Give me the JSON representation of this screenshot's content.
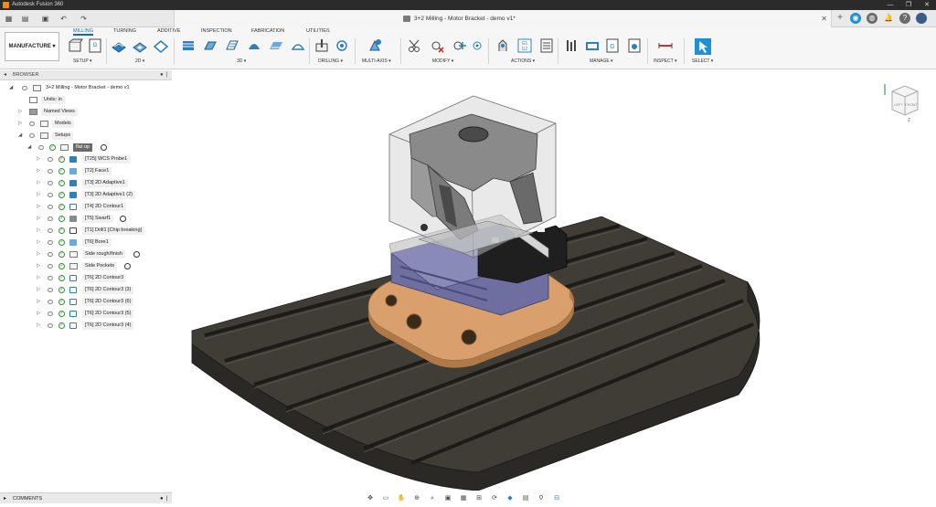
{
  "window": {
    "app_title": "Autodesk Fusion 360",
    "controls": [
      "—",
      "❐",
      "✕"
    ]
  },
  "quick_access": {
    "icons": [
      "grid-icon",
      "file-icon",
      "save-icon",
      "undo-icon",
      "redo-icon"
    ],
    "glyphs": [
      "▦",
      "▤",
      "▣",
      "↶",
      "↷"
    ]
  },
  "document": {
    "title": "3+2 Milling - Motor Bracket - demo v1*",
    "close": "✕"
  },
  "right_controls": {
    "add": "+",
    "glyphs": [
      "◉",
      "◍",
      "🔔",
      "?"
    ]
  },
  "ribbon": {
    "workspace": "MANUFACTURE ▾",
    "tabs": [
      "MILLING",
      "TURNING",
      "ADDITIVE",
      "INSPECTION",
      "FABRICATION",
      "UTILITIES"
    ],
    "active_tab": "MILLING",
    "groups": [
      {
        "label": "SETUP ▾"
      },
      {
        "label": "2D ▾"
      },
      {
        "label": "3D ▾"
      },
      {
        "label": "DRILLING ▾"
      },
      {
        "label": "MULTI-AXIS ▾"
      },
      {
        "label": "MODIFY ▾"
      },
      {
        "label": "ACTIONS ▾"
      },
      {
        "label": "MANAGE ▾"
      },
      {
        "label": "INSPECT ▾"
      },
      {
        "label": "SELECT ▾"
      }
    ],
    "actions_g1g2": "G1\nG2",
    "setup_g": "G"
  },
  "browser": {
    "title": "BROWSER",
    "tree": [
      {
        "label": "3+2 Milling - Motor Bracket - demo v1",
        "level": 0
      },
      {
        "label": "Units: in",
        "level": 1
      },
      {
        "label": "Named Views",
        "level": 1
      },
      {
        "label": "Models",
        "level": 1
      },
      {
        "label": "Setups",
        "level": 1
      },
      {
        "label": "flat op",
        "level": 2,
        "selected": true
      },
      {
        "label": "[T25] WCS Probe1",
        "level": 3
      },
      {
        "label": "[T2] Face1",
        "level": 3
      },
      {
        "label": "[T3] 2D Adaptive1",
        "level": 3
      },
      {
        "label": "[T3] 2D Adaptive1 (2)",
        "level": 3
      },
      {
        "label": "[T4] 2D Contour1",
        "level": 3
      },
      {
        "label": "[T5] Swarf1",
        "level": 3
      },
      {
        "label": "[T1] Drill1 [Chip breaking]",
        "level": 3
      },
      {
        "label": "[T6] Bore1",
        "level": 3
      },
      {
        "label": "Side rough/finish",
        "level": 3
      },
      {
        "label": "Side Pockets",
        "level": 3
      },
      {
        "label": "[T6] 2D Contour3",
        "level": 3
      },
      {
        "label": "[T6] 2D Contour3 (3)",
        "level": 3
      },
      {
        "label": "[T6] 2D Contour3 (6)",
        "level": 3
      },
      {
        "label": "[T6] 2D Contour3 (5)",
        "level": 3
      },
      {
        "label": "[T6] 2D Contour3 (4)",
        "level": 3
      }
    ]
  },
  "comments": {
    "title": "COMMENTS"
  },
  "viewcube": {
    "left": "LEFT",
    "front": "FRONT",
    "axis": "Z"
  },
  "navbar": {
    "icons": [
      "orbit-icon",
      "pan-icon",
      "hand-icon",
      "zoom-icon",
      "fit-icon",
      "display-icon",
      "grid-icon",
      "snap-icon",
      "refresh-icon",
      "visual-icon",
      "table-icon",
      "filter-icon",
      "section-icon"
    ],
    "glyphs": [
      "✥",
      "▭",
      "✋",
      "⊕",
      "⌕",
      "▣",
      "▦",
      "⊞",
      "⟳",
      "◆",
      "▤",
      "⚲",
      "⊟"
    ]
  },
  "colors": {
    "accent": "#0f6cbd",
    "table": "#3f3d36",
    "copper": "#d9a06e",
    "vise": "#6e6ea0"
  }
}
